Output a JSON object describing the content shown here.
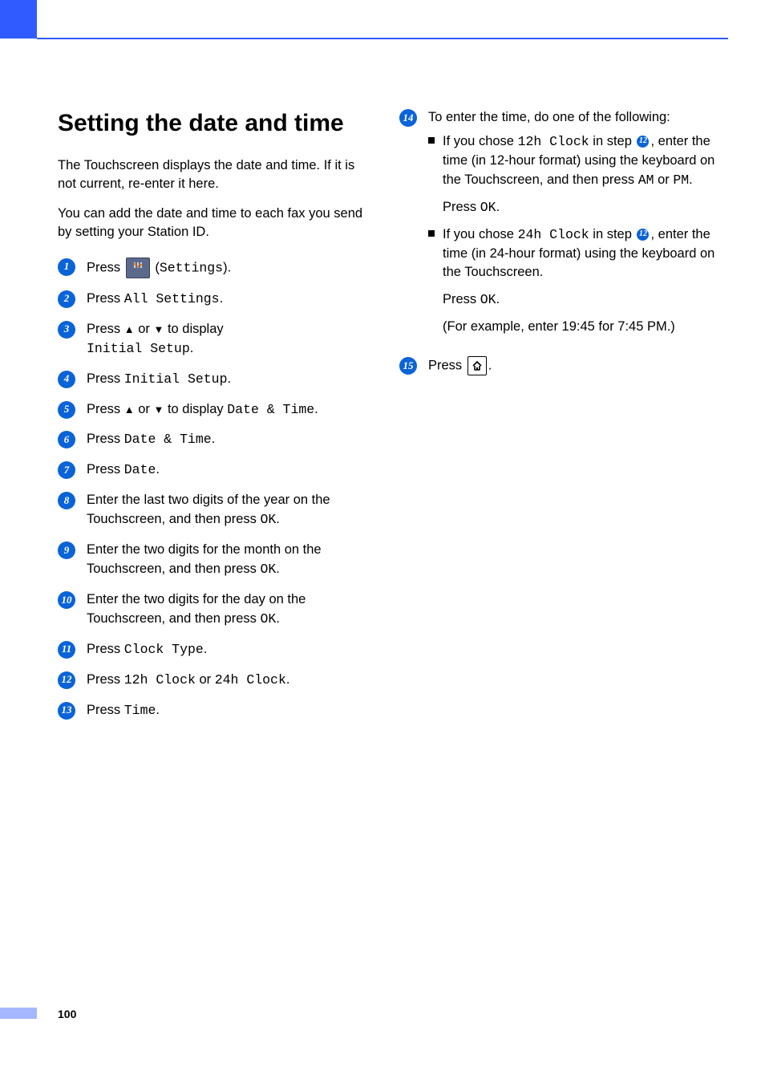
{
  "pageNumber": "100",
  "title": "Setting the date and time",
  "intro1": "The Touchscreen displays the date and time. If it is not current, re-enter it here.",
  "intro2": "You can add the date and time to each fax you send by setting your Station ID.",
  "steps": {
    "s1": {
      "num": "1",
      "t1": "Press ",
      "t2": " (",
      "m1": "Settings",
      "t3": ")."
    },
    "s2": {
      "num": "2",
      "t1": "Press ",
      "m1": "All Settings",
      "t2": "."
    },
    "s3": {
      "num": "3",
      "t1": "Press ",
      "t2": " or ",
      "t3": " to display ",
      "m1": "Initial Setup",
      "t4": "."
    },
    "s4": {
      "num": "4",
      "t1": "Press ",
      "m1": "Initial Setup",
      "t2": "."
    },
    "s5": {
      "num": "5",
      "t1": "Press ",
      "t2": " or ",
      "t3": " to display ",
      "m1": "Date & Time",
      "t4": "."
    },
    "s6": {
      "num": "6",
      "t1": "Press ",
      "m1": "Date & Time",
      "t2": "."
    },
    "s7": {
      "num": "7",
      "t1": "Press ",
      "m1": "Date",
      "t2": "."
    },
    "s8": {
      "num": "8",
      "t1": "Enter the last two digits of the year on the Touchscreen, and then press ",
      "m1": "OK",
      "t2": "."
    },
    "s9": {
      "num": "9",
      "t1": "Enter the two digits for the month on the Touchscreen, and then press ",
      "m1": "OK",
      "t2": "."
    },
    "s10": {
      "num": "10",
      "t1": "Enter the two digits for the day on the Touchscreen, and then press ",
      "m1": "OK",
      "t2": "."
    },
    "s11": {
      "num": "11",
      "t1": "Press ",
      "m1": "Clock Type",
      "t2": "."
    },
    "s12": {
      "num": "12",
      "t1": "Press ",
      "m1": "12h Clock",
      "t2": " or ",
      "m2": "24h Clock",
      "t3": "."
    },
    "s13": {
      "num": "13",
      "t1": "Press ",
      "m1": "Time",
      "t2": "."
    },
    "s14": {
      "num": "14",
      "t1": "To enter the time, do one of the following:",
      "a": {
        "t1": "If you chose ",
        "m1": "12h Clock",
        "t2": " in step ",
        "ref": "12",
        "t3": ", enter the time (in 12-hour format) using the keyboard on the Touchscreen, and then press ",
        "m2": "AM",
        "t4": " or ",
        "m3": "PM",
        "t5": ".",
        "p2a": "Press ",
        "p2m": "OK",
        "p2b": "."
      },
      "b": {
        "t1": "If you chose ",
        "m1": "24h Clock",
        "t2": " in step ",
        "ref": "12",
        "t3": ", enter the time (in 24-hour format) using the keyboard on the Touchscreen.",
        "p2a": "Press ",
        "p2m": "OK",
        "p2b": ".",
        "p3": "(For example, enter 19:45 for 7:45 PM.)"
      }
    },
    "s15": {
      "num": "15",
      "t1": "Press ",
      "t2": "."
    }
  },
  "glyphs": {
    "up": "▲",
    "down": "▼"
  }
}
